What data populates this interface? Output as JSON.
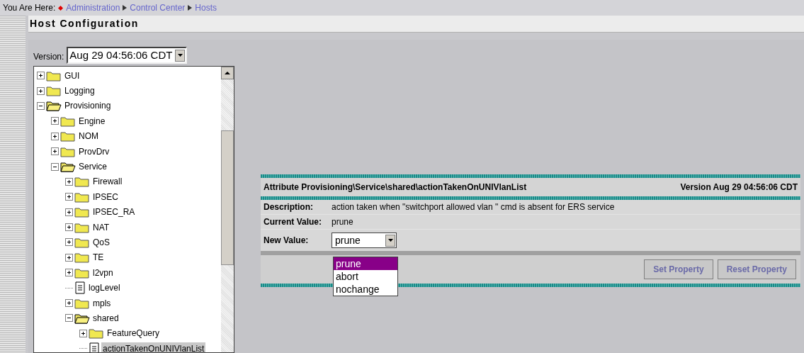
{
  "breadcrumb": {
    "label": "You Are Here:",
    "links": [
      "Administration",
      "Control Center",
      "Hosts"
    ]
  },
  "page_title": "Host Configuration",
  "version_select": {
    "label": "Version:",
    "value": "Aug 29 04:56:06 CDT"
  },
  "tree": [
    {
      "label": "GUI",
      "kind": "folder",
      "expanded": false,
      "selected": false
    },
    {
      "label": "Logging",
      "kind": "folder",
      "expanded": false,
      "selected": false
    },
    {
      "label": "Provisioning",
      "kind": "folder",
      "expanded": true,
      "selected": false,
      "children": [
        {
          "label": "Engine",
          "kind": "folder",
          "expanded": false,
          "selected": false
        },
        {
          "label": "NOM",
          "kind": "folder",
          "expanded": false,
          "selected": false
        },
        {
          "label": "ProvDrv",
          "kind": "folder",
          "expanded": false,
          "selected": false
        },
        {
          "label": "Service",
          "kind": "folder",
          "expanded": true,
          "selected": false,
          "children": [
            {
              "label": "Firewall",
              "kind": "folder",
              "expanded": false,
              "selected": false
            },
            {
              "label": "IPSEC",
              "kind": "folder",
              "expanded": false,
              "selected": false
            },
            {
              "label": "IPSEC_RA",
              "kind": "folder",
              "expanded": false,
              "selected": false
            },
            {
              "label": "NAT",
              "kind": "folder",
              "expanded": false,
              "selected": false
            },
            {
              "label": "QoS",
              "kind": "folder",
              "expanded": false,
              "selected": false
            },
            {
              "label": "TE",
              "kind": "folder",
              "expanded": false,
              "selected": false
            },
            {
              "label": "l2vpn",
              "kind": "folder",
              "expanded": false,
              "selected": false
            },
            {
              "label": "logLevel",
              "kind": "leaf",
              "selected": false
            },
            {
              "label": "mpls",
              "kind": "folder",
              "expanded": false,
              "selected": false
            },
            {
              "label": "shared",
              "kind": "folder",
              "expanded": true,
              "selected": false,
              "children": [
                {
                  "label": "FeatureQuery",
                  "kind": "folder",
                  "expanded": false,
                  "selected": false
                },
                {
                  "label": "actionTakenOnUNIVlanList",
                  "kind": "leaf",
                  "selected": true
                }
              ]
            }
          ]
        }
      ]
    }
  ],
  "attribute": {
    "title": "Attribute Provisioning\\Service\\shared\\actionTakenOnUNIVlanList",
    "version": "Version Aug 29 04:56:06 CDT",
    "rows": [
      {
        "label": "Description:",
        "value": "action taken when \"switchport allowed vlan \" cmd is absent for ERS service"
      },
      {
        "label": "Current Value:",
        "value": "prune"
      }
    ],
    "new_value": {
      "label": "New Value:",
      "value": "prune",
      "open": true,
      "options": [
        {
          "label": "prune",
          "selected": true
        },
        {
          "label": "abort",
          "selected": false
        },
        {
          "label": "nochange",
          "selected": false
        }
      ]
    },
    "buttons": [
      {
        "label": "Set Property",
        "disabled": true
      },
      {
        "label": "Reset Property",
        "disabled": true
      }
    ]
  }
}
